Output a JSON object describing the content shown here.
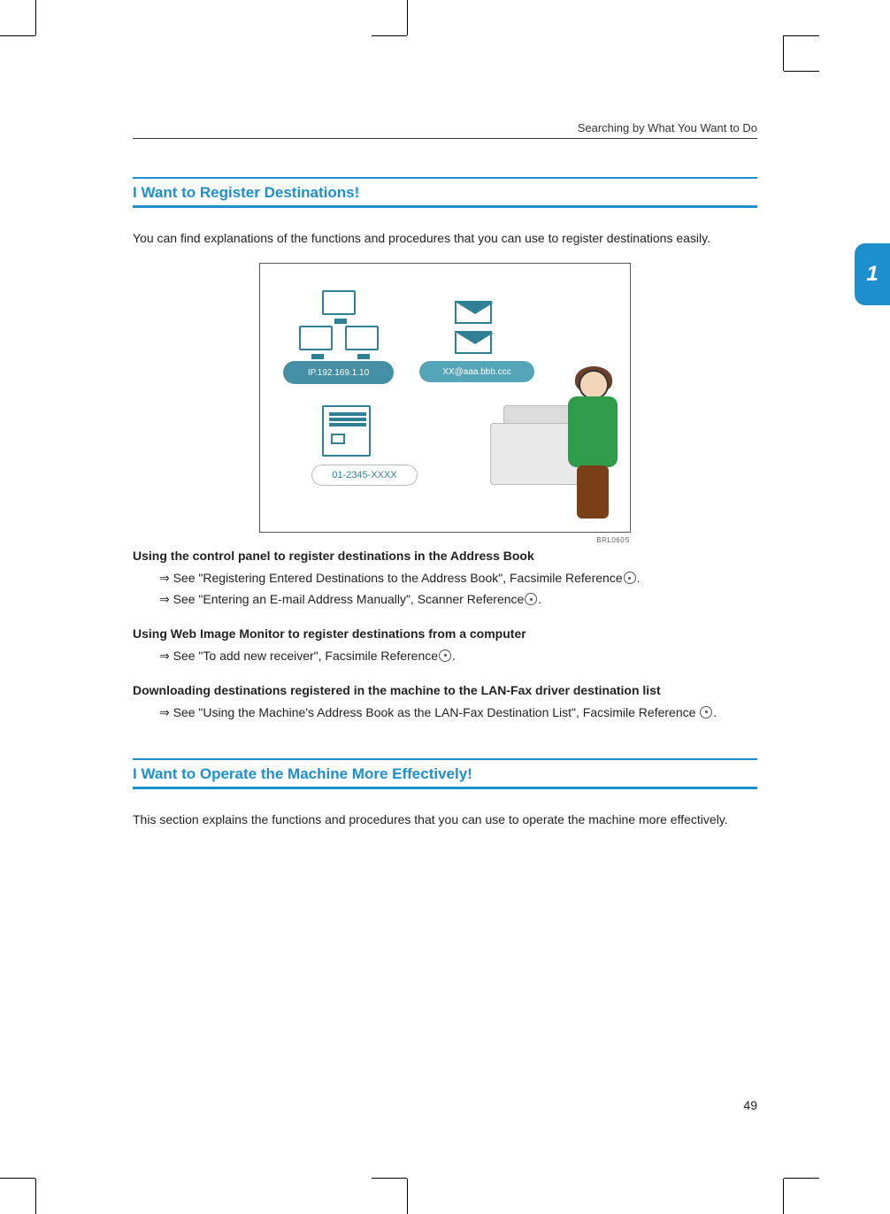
{
  "header": {
    "running_head": "Searching by What You Want to Do"
  },
  "side_tab": {
    "label": "1"
  },
  "section1": {
    "title": "I Want to Register Destinations!",
    "intro": "You can find explanations of the functions and procedures that you can use to register destinations easily.",
    "figure": {
      "ip_label": "IP.192.169.1.10",
      "email_label": "XX@aaa.bbb.ccc",
      "fax_label": "01-2345-XXXX",
      "code": "BRL060S"
    },
    "sub1": {
      "heading": "Using the control panel to register destinations in the Address Book",
      "ref1_pre": "⇒ See \"Registering Entered Destinations to the Address Book\", Facsimile Reference",
      "ref1_post": ".",
      "ref2_pre": "⇒ See \"Entering an E-mail Address Manually\", Scanner Reference",
      "ref2_post": "."
    },
    "sub2": {
      "heading": "Using Web Image Monitor to register destinations from a computer",
      "ref1_pre": "⇒ See \"To add new receiver\", Facsimile Reference",
      "ref1_post": "."
    },
    "sub3": {
      "heading": "Downloading destinations registered in the machine to the LAN-Fax driver destination list",
      "ref1_pre": "⇒ See \"Using the Machine's Address Book as the LAN-Fax Destination List\", Facsimile Reference ",
      "ref1_post": "."
    }
  },
  "section2": {
    "title": "I Want to Operate the Machine More Effectively!",
    "intro": "This section explains the functions and procedures that you can use to operate the machine more effectively."
  },
  "footer": {
    "page_number": "49"
  }
}
